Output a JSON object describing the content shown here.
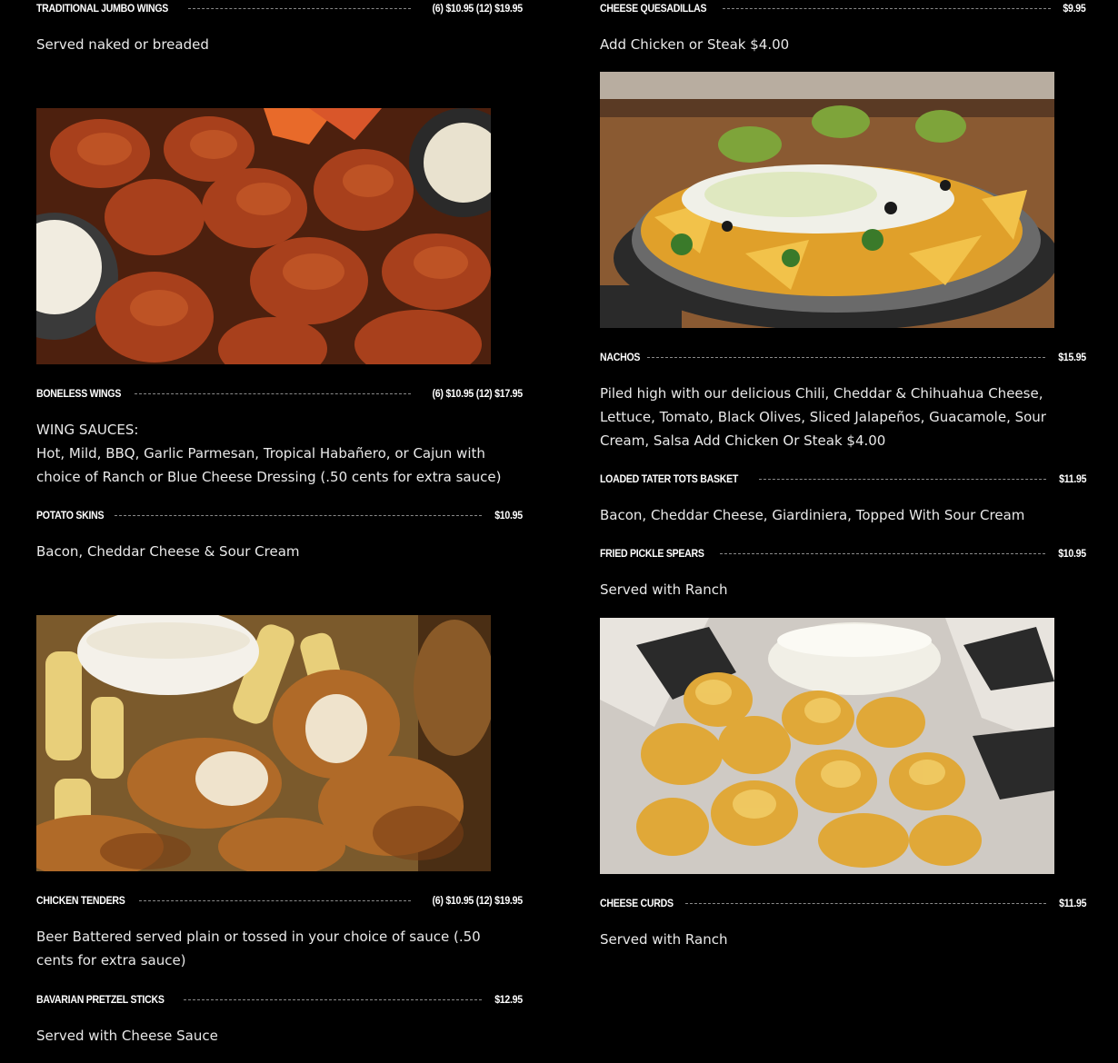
{
  "left": {
    "traditional_jumbo_wings": {
      "name": "TRADITIONAL JUMBO WINGS",
      "price": "(6) $10.95 (12) $19.95",
      "description": "Served naked or breaded"
    },
    "boneless_wings": {
      "name": "BONELESS WINGS",
      "price": "(6) $10.95 (12) $17.95",
      "description_line1": "WING SAUCES:",
      "description_line2": "Hot, Mild, BBQ, Garlic Parmesan, Tropical Habañero, or Cajun with",
      "description_line3": "choice of Ranch or Blue Cheese Dressing (.50 cents for extra sauce)"
    },
    "potato_skins": {
      "name": "POTATO SKINS",
      "price": "$10.95",
      "description": "Bacon, Cheddar Cheese & Sour Cream"
    },
    "chicken_tenders": {
      "name": "CHICKEN TENDERS",
      "price": "(6) $10.95 (12) $19.95",
      "description_line1": "Beer Battered served plain or tossed in your choice of sauce (.50",
      "description_line2": "cents for extra sauce)"
    },
    "bavarian_pretzel_sticks": {
      "name": "BAVARIAN PRETZEL STICKS",
      "price": "$12.95",
      "description": "Served with Cheese Sauce"
    }
  },
  "right": {
    "cheese_quesadillas": {
      "name": "CHEESE QUESADILLAS",
      "price": "$9.95",
      "description": "Add Chicken or Steak $4.00"
    },
    "nachos": {
      "name": "NACHOS",
      "price": "$15.95",
      "description_line1": "Piled high with our delicious Chili, Cheddar & Chihuahua Cheese,",
      "description_line2": "Lettuce, Tomato, Black Olives, Sliced Jalapeños, Guacamole, Sour",
      "description_line3": "Cream, Salsa Add Chicken Or Steak $4.00"
    },
    "loaded_tater_tots_basket": {
      "name": "LOADED TATER TOTS BASKET",
      "price": "$11.95",
      "description": "Bacon, Cheddar Cheese, Giardiniera, Topped With Sour Cream"
    },
    "fried_pickle_spears": {
      "name": "FRIED PICKLE SPEARS",
      "price": "$10.95",
      "description": "Served with Ranch"
    },
    "cheese_curds": {
      "name": "CHEESE CURDS",
      "price": "$11.95",
      "description": "Served with Ranch"
    }
  },
  "colors": {
    "background": "#000000",
    "text": "#ffffff",
    "description": "#e9e9e9",
    "leader": "#8a8a8a"
  },
  "icons": {
    "photo_boneless_wings": "boneless-wings-photo",
    "photo_nachos": "nachos-photo",
    "photo_chicken_tenders": "chicken-tenders-photo",
    "photo_cheese_curds": "cheese-curds-photo"
  }
}
